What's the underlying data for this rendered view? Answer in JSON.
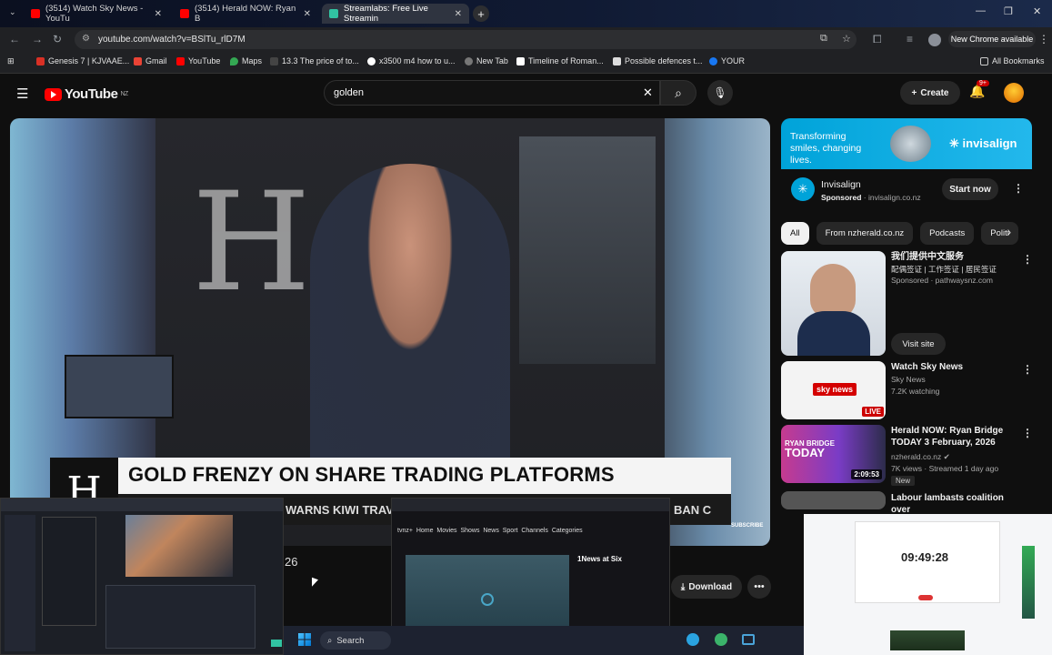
{
  "browser": {
    "tabs": [
      {
        "title": "(3514) Watch Sky News - YouTu",
        "active": false
      },
      {
        "title": "(3514) Herald NOW: Ryan B",
        "active": false
      },
      {
        "title": "Streamlabs: Free Live Streamin",
        "active": true
      }
    ],
    "url": "youtube.com/watch?v=BSlTu_rlD7M",
    "new_chrome_label": "New Chrome available",
    "bookmarks": [
      "Genesis 7 | KJVAAE...",
      "Gmail",
      "YouTube",
      "Maps",
      "13.3 The price of to...",
      "x3500 m4 how to u...",
      "New Tab",
      "Timeline of Roman...",
      "Possible defences t...",
      "YOUR"
    ],
    "all_bookmarks_label": "All Bookmarks"
  },
  "youtube": {
    "logo_text": "YouTube",
    "region": "NZ",
    "search_query": "golden",
    "create_label": "Create",
    "notifications_badge": "9+"
  },
  "video": {
    "headline": "GOLD FRENZY ON SHARE TRADING PLATFORMS",
    "ticker": "WARNS KIWI TRAV",
    "ticker_end": "BAN C",
    "subscribe_overlay": "SUBSCRIBE",
    "part_number": "26",
    "download_label": "Download"
  },
  "ad": {
    "banner_tagline": "Transforming smiles, changing lives.",
    "banner_brand": "invisalign",
    "name": "Invisalign",
    "sponsored_label": "Sponsored",
    "domain": "invisalign.co.nz",
    "cta": "Start now"
  },
  "chips": [
    "All",
    "From nzherald.co.nz",
    "Podcasts",
    "Politi"
  ],
  "recommendations": [
    {
      "title_line1": "我们提供中文服务",
      "title_line2": "配偶签证 | 工作签证 | 居民签证",
      "meta": "Sponsored · pathwaysnz.com",
      "cta": "Visit site"
    },
    {
      "title": "Watch Sky News",
      "channel": "Sky News",
      "meta": "7.2K watching",
      "badge": "LIVE"
    },
    {
      "title": "Herald NOW: Ryan Bridge TODAY 3 February, 2026",
      "channel": "nzherald.co.nz",
      "meta": "7K views · Streamed 1 day ago",
      "duration": "2:09:53",
      "badge": "New"
    },
    {
      "title": "Labour lambasts coalition over"
    }
  ],
  "taskbar": {
    "search_label": "Search",
    "preview_clock": "09:49:28"
  },
  "colors": {
    "yt_red": "#ff0000",
    "invisalign_blue": "#00a3d9",
    "background": "#0f0f0f"
  }
}
